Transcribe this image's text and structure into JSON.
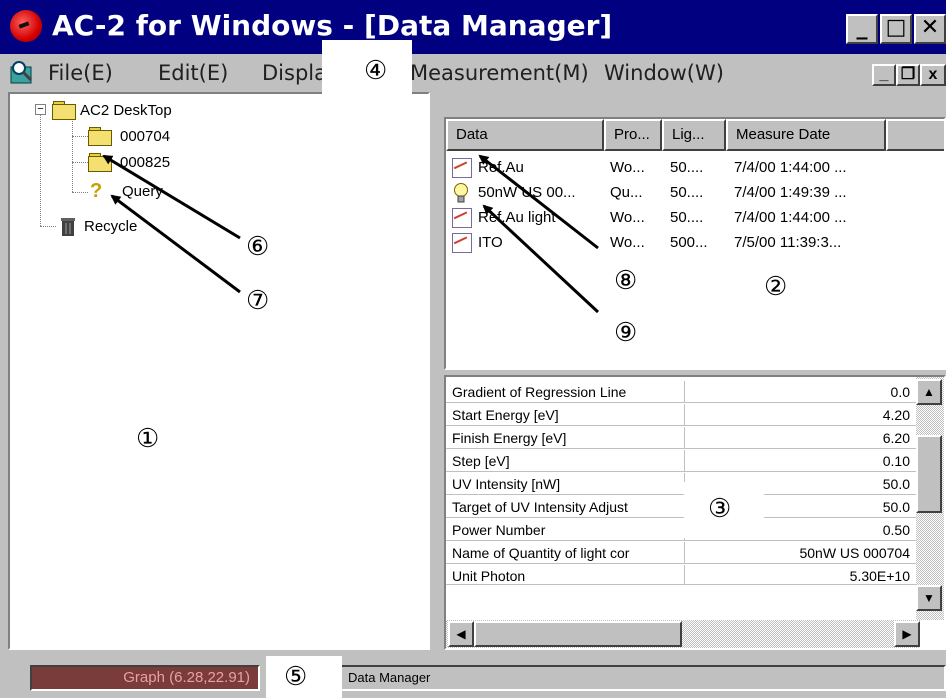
{
  "window": {
    "title": "AC-2 for Windows - [Data Manager]",
    "minimize": "_",
    "maximize": "□",
    "close": "✕"
  },
  "menu": {
    "items": [
      "File(E)",
      "Edit(E)",
      "Display(",
      "Measurement(M)",
      "Window(W)"
    ],
    "mdi_min": "_",
    "mdi_restore": "❐",
    "mdi_close": "x"
  },
  "tree": {
    "root": "AC2 DeskTop",
    "children": [
      "000704",
      "000825",
      "Query"
    ],
    "recycle": "Recycle",
    "expander": "−"
  },
  "list": {
    "columns": [
      "Data",
      "Pro...",
      "Lig...",
      "Measure Date"
    ],
    "rows": [
      {
        "name": "Ref.Au",
        "pro": "Wo...",
        "lig": "50....",
        "date": "7/4/00 1:44:00 ...",
        "icon": "graph-icon"
      },
      {
        "name": "50nW US 00...",
        "pro": "Qu...",
        "lig": "50....",
        "date": "7/4/00 1:49:39 ...",
        "icon": "lightbulb-icon"
      },
      {
        "name": "Ref.Au light",
        "pro": "Wo...",
        "lig": "50....",
        "date": "7/4/00 1:44:00 ...",
        "icon": "graph-icon"
      },
      {
        "name": "ITO",
        "pro": "Wo...",
        "lig": "500...",
        "date": "7/5/00 11:39:3...",
        "icon": "graph-icon"
      }
    ]
  },
  "properties": {
    "rows": [
      {
        "name": "Gradient of Regression Line",
        "value": "0.0"
      },
      {
        "name": "Start Energy [eV]",
        "value": "4.20"
      },
      {
        "name": "Finish Energy [eV]",
        "value": "6.20"
      },
      {
        "name": "Step [eV]",
        "value": "0.10"
      },
      {
        "name": "UV Intensity [nW]",
        "value": "50.0"
      },
      {
        "name": "Target of UV Intensity Adjust",
        "value": "50.0"
      },
      {
        "name": "Power Number",
        "value": "0.50"
      },
      {
        "name": "Name of Quantity of light cor",
        "value": "50nW US 000704"
      },
      {
        "name": "Unit Photon",
        "value": "5.30E+10"
      }
    ]
  },
  "status": {
    "graph": "Graph (6.28,22.91)",
    "message": "Data Manager"
  },
  "callouts": [
    "①",
    "②",
    "③",
    "④",
    "⑤",
    "⑥",
    "⑦",
    "⑧",
    "⑨"
  ],
  "scroll": {
    "up": "▲",
    "down": "▼",
    "left": "◀",
    "right": "▶"
  }
}
